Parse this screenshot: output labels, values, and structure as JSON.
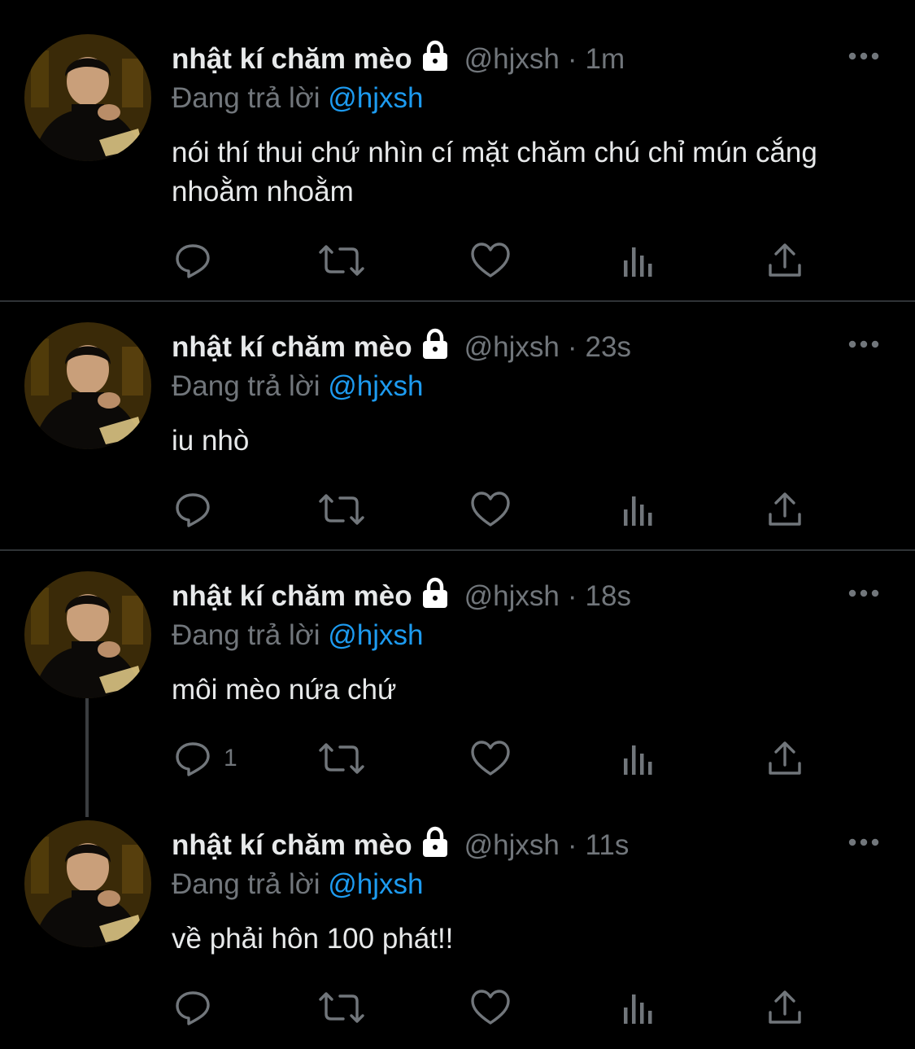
{
  "colors": {
    "background": "#000000",
    "text": "#e7e9ea",
    "secondary": "#71767b",
    "mention": "#1d9bf0",
    "divider": "#2f3336"
  },
  "tweets": [
    {
      "display_name": "nhật kí chăm mèo",
      "handle": "@hjxsh",
      "separator": "·",
      "time": "1m",
      "reply_prefix": "Đang trả lời",
      "reply_to": "@hjxsh",
      "text": "nói thí thui chứ nhìn cí mặt chăm chú chỉ mún cắng nhoằm nhoằm",
      "reply_count": "",
      "icons": [
        "lock-icon",
        "more-icon",
        "reply-icon",
        "retweet-icon",
        "like-icon",
        "analytics-icon",
        "share-icon"
      ]
    },
    {
      "display_name": "nhật kí chăm mèo",
      "handle": "@hjxsh",
      "separator": "·",
      "time": "23s",
      "reply_prefix": "Đang trả lời",
      "reply_to": "@hjxsh",
      "text": "iu nhò",
      "reply_count": ""
    },
    {
      "display_name": "nhật kí chăm mèo",
      "handle": "@hjxsh",
      "separator": "·",
      "time": "18s",
      "reply_prefix": "Đang trả lời",
      "reply_to": "@hjxsh",
      "text": "môi mèo nứa chứ",
      "reply_count": "1"
    },
    {
      "display_name": "nhật kí chăm mèo",
      "handle": "@hjxsh",
      "separator": "·",
      "time": "11s",
      "reply_prefix": "Đang trả lời",
      "reply_to": "@hjxsh",
      "text": "về phải hôn 100 phát!!",
      "reply_count": ""
    }
  ]
}
